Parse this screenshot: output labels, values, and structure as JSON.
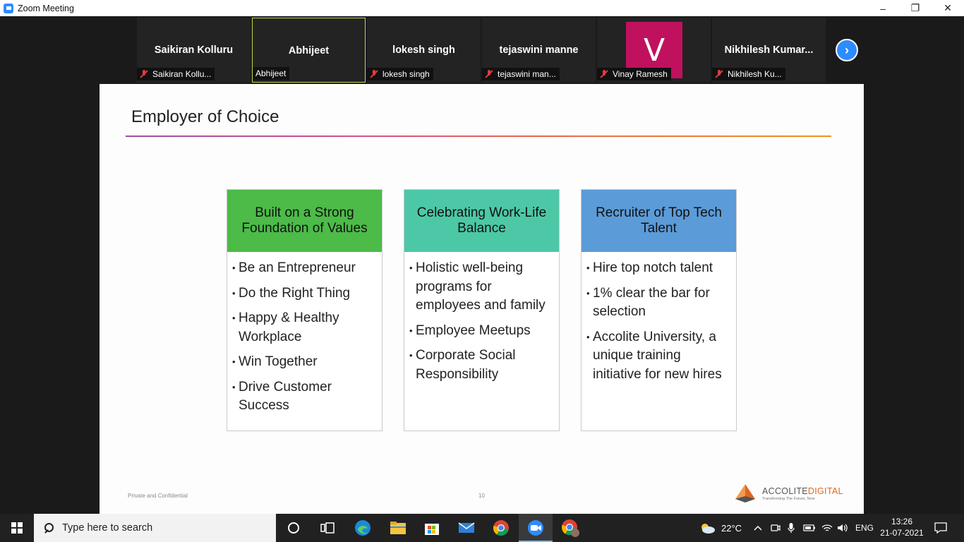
{
  "window": {
    "title": "Zoom Meeting",
    "minimize": "–",
    "restore": "❐",
    "close": "✕"
  },
  "participants": [
    {
      "name": "Saikiran Kolluru",
      "label": "Saikiran Kollu...",
      "muted": true
    },
    {
      "name": "Abhijeet",
      "label": "Abhijeet",
      "muted": false
    },
    {
      "name": "lokesh singh",
      "label": "lokesh singh",
      "muted": true
    },
    {
      "name": "tejaswini manne",
      "label": "tejaswini man...",
      "muted": true
    },
    {
      "avatar_letter": "V",
      "label": "Vinay Ramesh",
      "muted": true
    },
    {
      "name": "Nikhilesh  Kumar...",
      "label": "Nikhilesh Ku...",
      "muted": true
    }
  ],
  "next_arrow": "›",
  "slide": {
    "title": "Employer of Choice",
    "cards": [
      {
        "header": "Built on a Strong Foundation of Values",
        "color": "#4cbb48",
        "items": [
          "Be an Entrepreneur",
          "Do the Right Thing",
          "Happy & Healthy Workplace",
          "Win Together",
          "Drive Customer Success"
        ]
      },
      {
        "header": "Celebrating Work-Life Balance",
        "color": "#4cc8a7",
        "items": [
          "Holistic well-being programs for employees and family",
          "Employee Meetups",
          "Corporate Social Responsibility"
        ]
      },
      {
        "header": "Recruiter of Top Tech Talent",
        "color": "#5b9bd8",
        "items": [
          "Hire top notch talent",
          "1% clear the bar for selection",
          "Accolite University, a unique training initiative for new hires"
        ]
      }
    ],
    "footer_left": "Private and Confidential",
    "page_number": "10",
    "logo": {
      "name_a": "ACCOLITE",
      "name_b": "DIGITAL",
      "tagline": "Transforming The Future, Now"
    }
  },
  "taskbar": {
    "search_placeholder": "Type here to search",
    "temperature": "22°C",
    "language": "ENG",
    "time": "13:26",
    "date": "21-07-2021"
  }
}
